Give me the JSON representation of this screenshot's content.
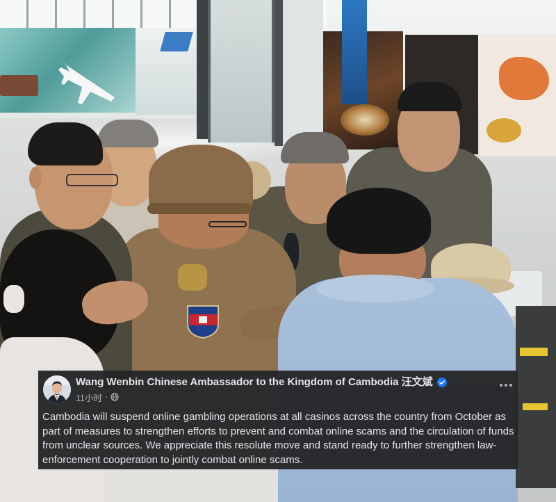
{
  "post": {
    "author": "Wang Wenbin Chinese Ambassador to the Kingdom of Cambodia 汪文斌",
    "verified": true,
    "timestamp": "11小时",
    "separator": "·",
    "body": "Cambodia will suspend online gambling operations at all casinos across the country from October as part of measures to strengthen efforts to prevent and combat online scams and the circulation of funds from unclear sources. We appreciate this resolute move and stand ready to further strengthen law-enforcement cooperation to jointly combat online scams."
  },
  "icons": {
    "avatar": "author-avatar",
    "verified": "verified-badge-icon",
    "audience": "globe-icon",
    "more": "more-options-icon"
  },
  "colors": {
    "card_background": "#242526",
    "primary_text": "#e4e6eb",
    "secondary_text": "#b0b3b8",
    "verified_badge": "#1877f2"
  }
}
